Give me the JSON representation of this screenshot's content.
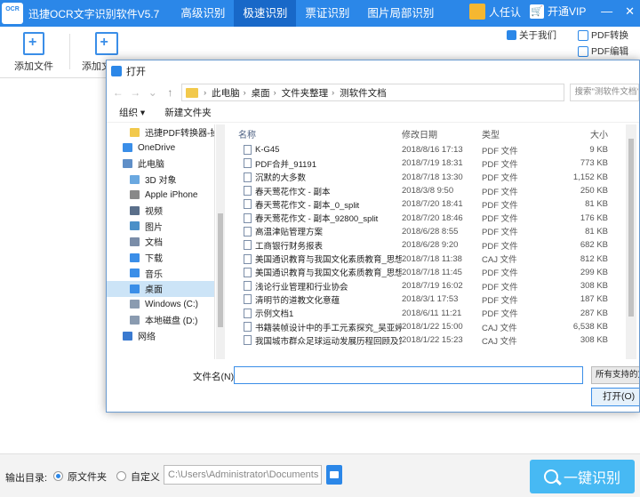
{
  "app": {
    "logo_text": "OCR",
    "name": "迅捷OCR文字识别软件V5.7",
    "tabs": [
      "高级识别",
      "极速识别",
      "票证识别",
      "图片局部识别"
    ],
    "active_tab": 1,
    "user_label": "人任认",
    "vip_label": "开通VIP",
    "window_buttons": {
      "minimize": "—",
      "close": "✕"
    },
    "accent_color": "#2b87e8"
  },
  "toolbar": {
    "add_file_label": "添加文件",
    "add_folder_label": "添加文件夹",
    "about_label": "关于我们",
    "pdf_convert_label": "PDF转换",
    "pdf_edit_label": "PDF编辑"
  },
  "bottom": {
    "output_label": "输出目录:",
    "radio_original": "原文件夹",
    "radio_custom": "自定义",
    "path_value": "C:\\Users\\Administrator\\Documents",
    "ocr_button": "一键识别"
  },
  "dialog": {
    "title": "打开",
    "breadcrumbs": [
      "此电脑",
      "桌面",
      "文件夹整理",
      "测软件文档"
    ],
    "search_placeholder": "搜索\"测软件文档\"",
    "organize_label": "组织 ▾",
    "new_folder_label": "新建文件夹",
    "nav_items": [
      {
        "label": "迅捷PDF转换器-操作",
        "indent": 1,
        "icon": "folder",
        "selected": false
      },
      {
        "label": "OneDrive",
        "indent": 0,
        "icon": "cloud",
        "selected": false
      },
      {
        "label": "此电脑",
        "indent": 0,
        "icon": "computer",
        "selected": false
      },
      {
        "label": "3D 对象",
        "indent": 1,
        "icon": "3d",
        "selected": false
      },
      {
        "label": "Apple iPhone",
        "indent": 1,
        "icon": "phone",
        "selected": false
      },
      {
        "label": "视频",
        "indent": 1,
        "icon": "video",
        "selected": false
      },
      {
        "label": "图片",
        "indent": 1,
        "icon": "picture",
        "selected": false
      },
      {
        "label": "文档",
        "indent": 1,
        "icon": "document",
        "selected": false
      },
      {
        "label": "下载",
        "indent": 1,
        "icon": "download",
        "selected": false
      },
      {
        "label": "音乐",
        "indent": 1,
        "icon": "music",
        "selected": false
      },
      {
        "label": "桌面",
        "indent": 1,
        "icon": "desktop",
        "selected": true
      },
      {
        "label": "Windows (C:)",
        "indent": 1,
        "icon": "drive",
        "selected": false
      },
      {
        "label": "本地磁盘 (D:)",
        "indent": 1,
        "icon": "drive",
        "selected": false
      },
      {
        "label": "网络",
        "indent": 0,
        "icon": "network",
        "selected": false
      }
    ],
    "columns": {
      "name": "名称",
      "date": "修改日期",
      "type": "类型",
      "size": "大小"
    },
    "files": [
      {
        "name": "K-G45",
        "date": "2018/8/16 17:13",
        "type": "PDF 文件",
        "size": "9 KB"
      },
      {
        "name": "PDF合并_91191",
        "date": "2018/7/19 18:31",
        "type": "PDF 文件",
        "size": "773 KB"
      },
      {
        "name": "沉默的大多数",
        "date": "2018/7/18 13:30",
        "type": "PDF 文件",
        "size": "1,152 KB"
      },
      {
        "name": "春天莺花作文 - 副本",
        "date": "2018/3/8 9:50",
        "type": "PDF 文件",
        "size": "250 KB"
      },
      {
        "name": "春天莺花作文 - 副本_0_split",
        "date": "2018/7/20 18:41",
        "type": "PDF 文件",
        "size": "81 KB"
      },
      {
        "name": "春天莺花作文 - 副本_92800_split",
        "date": "2018/7/20 18:46",
        "type": "PDF 文件",
        "size": "176 KB"
      },
      {
        "name": "高温津贴管理方案",
        "date": "2018/6/28 8:55",
        "type": "PDF 文件",
        "size": "81 KB"
      },
      {
        "name": "工商银行财务报表",
        "date": "2018/6/28 9:20",
        "type": "PDF 文件",
        "size": "682 KB"
      },
      {
        "name": "美国通识教育与我国文化素质教育_思想...",
        "date": "2018/7/18 11:38",
        "type": "CAJ 文件",
        "size": "812 KB"
      },
      {
        "name": "美国通识教育与我国文化素质教育_思想...",
        "date": "2018/7/18 11:45",
        "type": "PDF 文件",
        "size": "299 KB"
      },
      {
        "name": "浅论行业管理和行业协会",
        "date": "2018/7/19 16:02",
        "type": "PDF 文件",
        "size": "308 KB"
      },
      {
        "name": "清明节的道教文化意蕴",
        "date": "2018/3/1 17:53",
        "type": "PDF 文件",
        "size": "187 KB"
      },
      {
        "name": "示例文档1",
        "date": "2018/6/11 11:21",
        "type": "PDF 文件",
        "size": "287 KB"
      },
      {
        "name": "书籍装帧设计中的手工元素探究_吴亚婷...",
        "date": "2018/1/22 15:00",
        "type": "CAJ 文件",
        "size": "6,538 KB"
      },
      {
        "name": "我国城市群众足球运动发展历程回顾及策...",
        "date": "2018/1/22 15:23",
        "type": "CAJ 文件",
        "size": "308 KB"
      }
    ],
    "filename_label": "文件名(N):",
    "filename_value": "",
    "filter_label": "所有支持的文件",
    "open_button": "打开(O)"
  }
}
